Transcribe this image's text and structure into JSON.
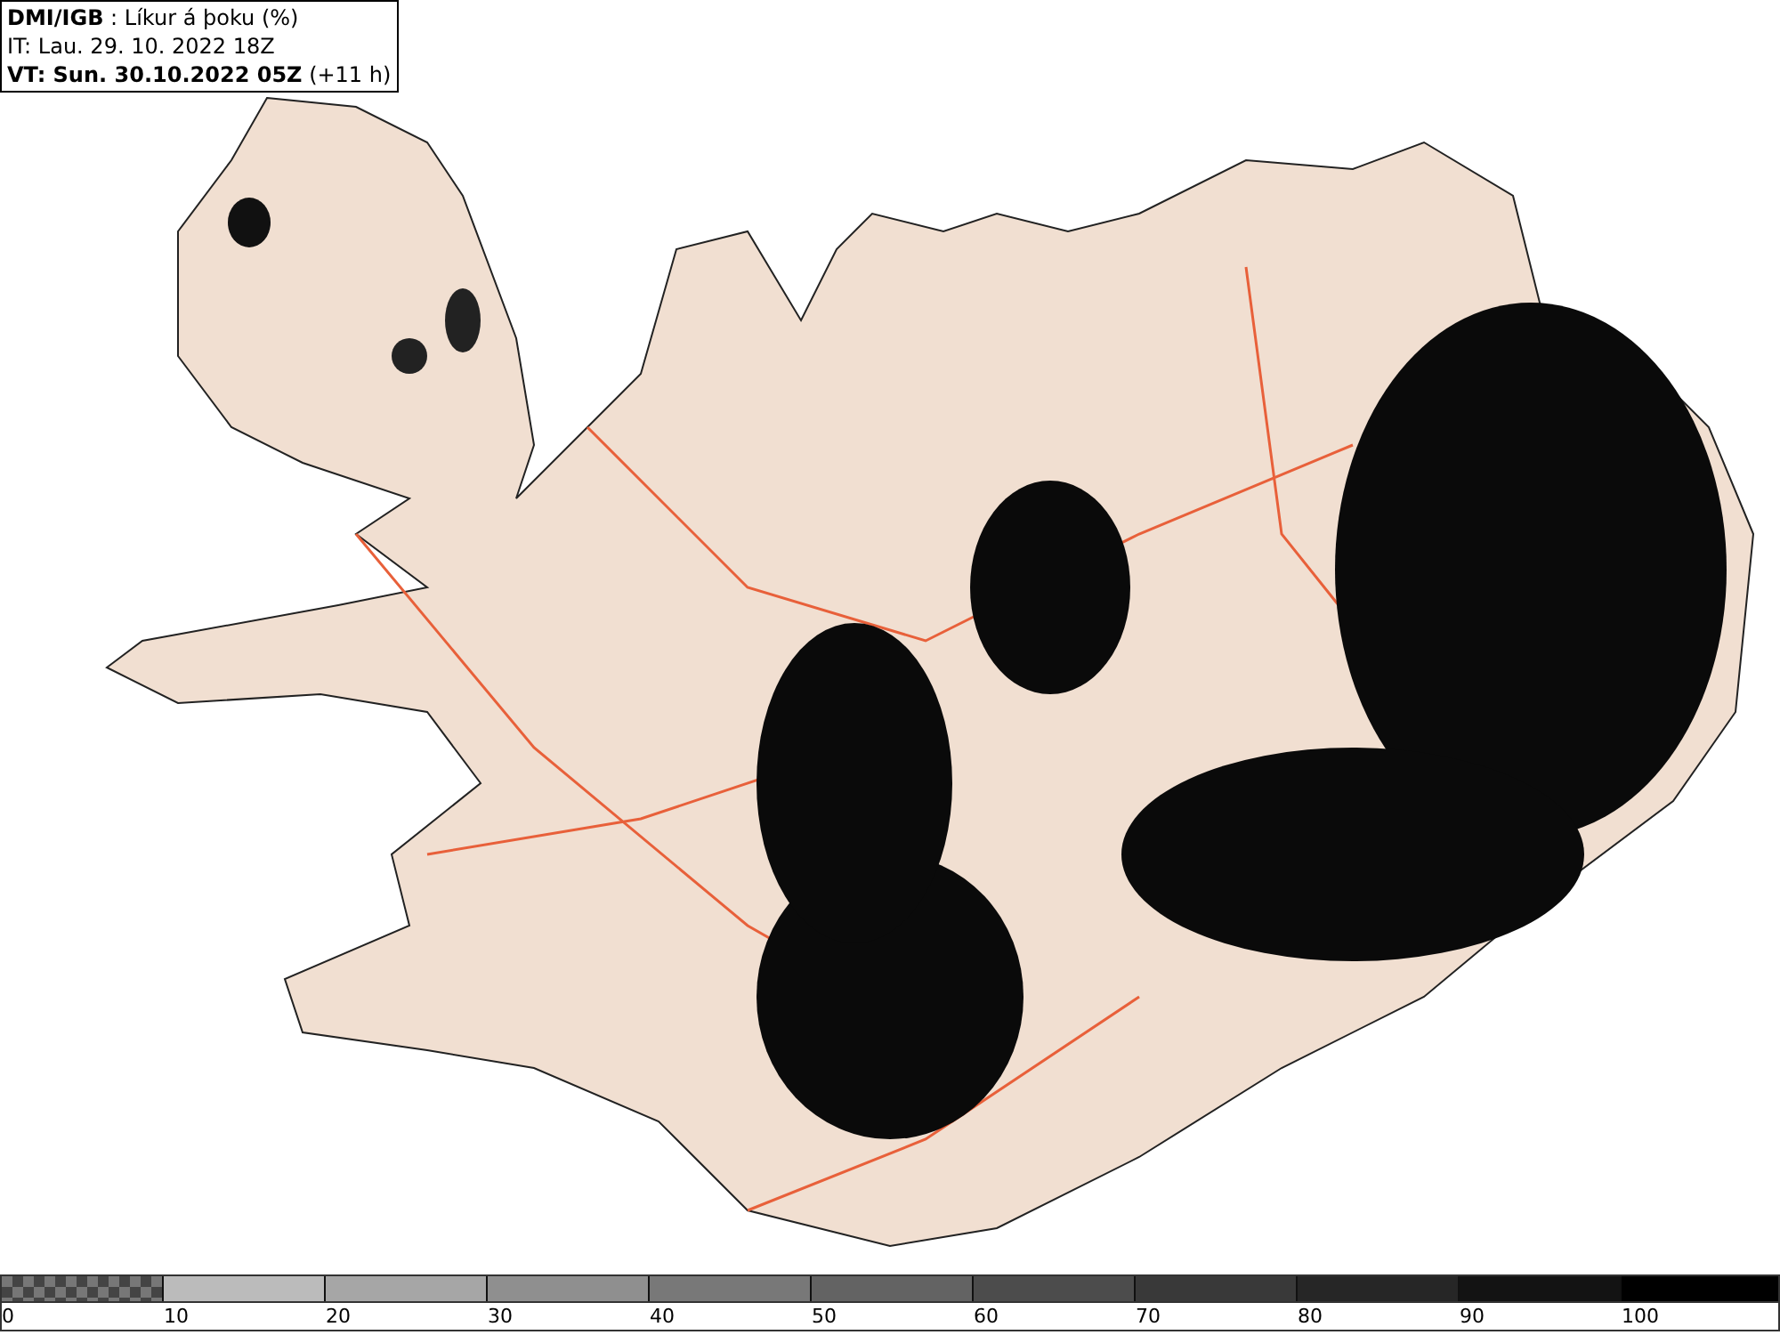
{
  "header": {
    "lines": [
      "**DMI/IGB** : Líkur á þoku (%)",
      "IT: Lau. 29. 10. 2022 18Z",
      "**VT: Sun. 30.10.2022 05Z** (+11 h)"
    ]
  },
  "legend": {
    "segments": [
      {
        "kind": "checkered",
        "color": "#777777"
      },
      {
        "kind": "solid",
        "color": "#bbbbbb"
      },
      {
        "kind": "solid",
        "color": "#a6a6a6"
      },
      {
        "kind": "solid",
        "color": "#8f8f8f"
      },
      {
        "kind": "solid",
        "color": "#787878"
      },
      {
        "kind": "solid",
        "color": "#636363"
      },
      {
        "kind": "solid",
        "color": "#4c4c4c"
      },
      {
        "kind": "solid",
        "color": "#393939"
      },
      {
        "kind": "solid",
        "color": "#262626"
      },
      {
        "kind": "solid",
        "color": "#131313"
      },
      {
        "kind": "solid",
        "color": "#000000"
      }
    ],
    "labels": [
      "0",
      "10",
      "20",
      "30",
      "40",
      "50",
      "60",
      "70",
      "80",
      "90",
      "100"
    ]
  }
}
